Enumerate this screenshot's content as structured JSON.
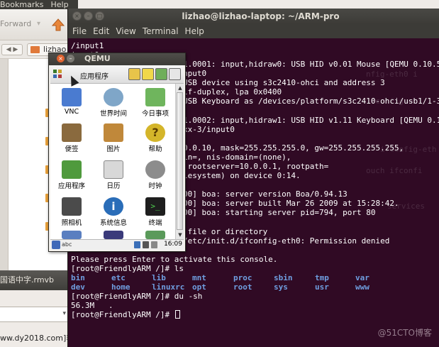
{
  "file_manager": {
    "menu": [
      "Bookmarks",
      "Help"
    ],
    "forward_label": "Forward",
    "breadcrumb": "lizhao",
    "strip_text": "国语中字.rmvb",
    "website_text": "ww.dy2018.com]非"
  },
  "terminal": {
    "title": "lizhao@lizhao-laptop: ~/ARM-pro",
    "menu": [
      "File",
      "Edit",
      "View",
      "Terminal",
      "Help"
    ],
    "lines": [
      "/input1",
      "input0",
      "1.0001: input,hidraw0: USB HID v0.01 Mouse [QEMU 0.10.50",
      "nput0",
      "USB device using s3c2410-ohci and address 3",
      "lf-duplex, lpa 0x0400",
      "USB Keyboard as /devices/platform/s3c2410-ohci/usb1/1-3/",
      "",
      "1.0002: input,hidraw1: USB HID v1.11 Keyboard [QEMU 0.10",
      "xx-3/input0",
      "",
      "0.0.10, mask=255.255.255.0, gw=255.255.255.255,",
      "in=, nis-domain=(none),",
      " rootserver=10.0.0.1, rootpath=",
      "lesystem) on device 0:14.",
      "",
      "00] boa: server version Boa/0.94.13",
      "00] boa: server built Mar 26 2009 at 15:28:42.",
      "00] boa: starting server pid=794, port 80",
      "",
      " file or directory",
      "/etc/init.d/ifconfig-eth0: Permission denied"
    ],
    "console_lines": [
      "Please press Enter to activate this console.",
      "[root@FriendlyARM /]# ls"
    ],
    "ls_columns": [
      [
        "bin",
        "dev"
      ],
      [
        "etc",
        "home"
      ],
      [
        "lib",
        "linuxrc"
      ],
      [
        "mnt",
        "opt"
      ],
      [
        "proc",
        "root"
      ],
      [
        "sbin",
        "sys"
      ],
      [
        "tmp",
        "usr"
      ],
      [
        "var",
        "www"
      ]
    ],
    "after_lines": [
      "[root@FriendlyARM /]# du -sh",
      "56.3M\t.",
      "[root@FriendlyARM /]# "
    ],
    "watermark": "@51CTO博客"
  },
  "qemu": {
    "title": "QEMU",
    "topbar_label": "应用程序",
    "apps": [
      {
        "label": "VNC",
        "icon": "vnc-icon",
        "color": "#4a7bd0"
      },
      {
        "label": "世界时间",
        "icon": "world-time-icon",
        "color": "#7fa6c8"
      },
      {
        "label": "今日事项",
        "icon": "today-icon",
        "color": "#6fb55d"
      },
      {
        "label": "便签",
        "icon": "notes-icon",
        "color": "#8a6a3e"
      },
      {
        "label": "图片",
        "icon": "pictures-icon",
        "color": "#c0883a"
      },
      {
        "label": "帮助",
        "icon": "help-icon",
        "color": "#d4b52a"
      },
      {
        "label": "应用程序",
        "icon": "applications-icon",
        "color": "#4f9a3d"
      },
      {
        "label": "日历",
        "icon": "calendar-icon",
        "color": "#d8d8d8"
      },
      {
        "label": "时钟",
        "icon": "clock-icon",
        "color": "#8c8c8c"
      },
      {
        "label": "照相机",
        "icon": "camera-icon",
        "color": "#4b4b4b"
      },
      {
        "label": "系统信息",
        "icon": "system-info-icon",
        "color": "#2a6db8"
      },
      {
        "label": "终端",
        "icon": "terminal-icon",
        "color": "#1e1e1e"
      }
    ],
    "clock": "16:09"
  }
}
